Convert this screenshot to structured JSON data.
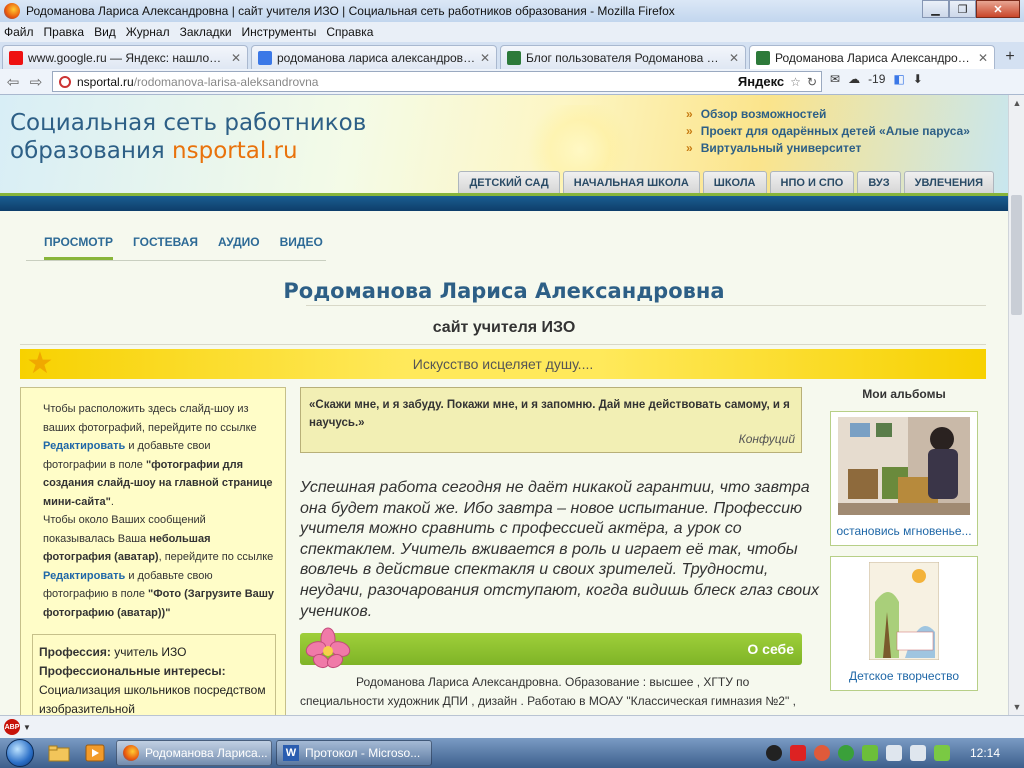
{
  "window": {
    "title": "Родоманова Лариса Александровна | сайт учителя ИЗО | Социальная сеть работников образования - Mozilla Firefox"
  },
  "menu": [
    "Файл",
    "Правка",
    "Вид",
    "Журнал",
    "Закладки",
    "Инструменты",
    "Справка"
  ],
  "tabs": [
    {
      "label": "www.google.ru — Яндекс: нашлось ...",
      "icon_color": "#e11"
    },
    {
      "label": "родоманова лариса александровна...",
      "icon_color": "#3b78e7"
    },
    {
      "label": "Блог пользователя Родоманова Ла...",
      "icon_color": "#2d7a3a"
    },
    {
      "label": "Родоманова Лариса Александровна...",
      "icon_color": "#2d7a3a"
    }
  ],
  "url": {
    "host": "nsportal.ru",
    "path": "/rodomanova-larisa-aleksandrovna"
  },
  "yandex_label": "Яндекс",
  "weather": "-19",
  "site": {
    "title_line1": "Социальная сеть работников",
    "title_line2": "образования",
    "brand": "nsportal.ru",
    "top_links": [
      "Обзор возможностей",
      "Проект для одарённых детей «Алые паруса»",
      "Виртуальный университет"
    ],
    "section_tabs": [
      "ДЕТСКИЙ САД",
      "НАЧАЛЬНАЯ ШКОЛА",
      "ШКОЛА",
      "НПО И СПО",
      "ВУЗ",
      "УВЛЕЧЕНИЯ"
    ]
  },
  "subnav": [
    "ПРОСМОТР",
    "ГОСТЕВАЯ",
    "АУДИО",
    "ВИДЕО"
  ],
  "page": {
    "name": "Родоманова Лариса Александровна",
    "subtitle": "сайт учителя ИЗО",
    "motto": "Искусство исцеляет душу...."
  },
  "left": {
    "help_1": "Чтобы расположить здесь слайд-шоу из ваших фотографий, перейдите по ссылке",
    "edit_link": "Редактировать",
    "help_2": "и добавьте свои фотографии в поле",
    "help_2b": "\"фотографии для создания слайд-шоу на главной странице мини-сайта\"",
    "help_3": "Чтобы около Ваших сообщений показывалась Ваша",
    "help_3b": "небольшая фотография (аватар)",
    "help_3c": ", перейдите по ссылке",
    "help_4": "и добавьте свою фотографию в поле",
    "help_4b": "\"Фото (Загрузите Вашу фотографию (аватар))\"",
    "profession_label": "Профессия:",
    "profession_value": "учитель ИЗО",
    "interests_label": "Профессиональные интересы:",
    "interests_value": "Социализация школьников посредством изобразительной"
  },
  "quote": {
    "text": "«Скажи мне, и я забуду. Покажи мне, и я запомню. Дай мне действовать самому, и я научусь.»",
    "author": "Конфуций"
  },
  "paragraph": "Успешная работа сегодня не даёт никакой гарантии, что завтра она будет такой же. Ибо завтра – новое испытание. Профессию учителя можно сравнить с профессией актёра, а урок со спектаклем. Учитель вживается в роль и играет её так, чтобы вовлечь в действие спектакля и своих зрителей. Трудности, неудачи, разочарования отступают, когда видишь блеск глаз своих учеников.",
  "about": {
    "title": "О себе",
    "text": "Родоманова Лариса Александровна. Образование : высшее , ХГТУ по специальности художник ДПИ , дизайн . Работаю в МОАУ \"Классическая гимназия №2\" , учителем ИЗО."
  },
  "albums": {
    "title": "Мои альбомы",
    "items": [
      {
        "label": "остановись мгновенье..."
      },
      {
        "label": "Детское творчество"
      }
    ]
  },
  "taskbar": {
    "tasks": [
      "Родоманова Лариса...",
      "Протокол - Microso..."
    ],
    "clock": "12:14"
  },
  "colors": {
    "accent_green": "#88b53a",
    "link_blue": "#2d5f86",
    "brand_orange": "#e9720b"
  }
}
